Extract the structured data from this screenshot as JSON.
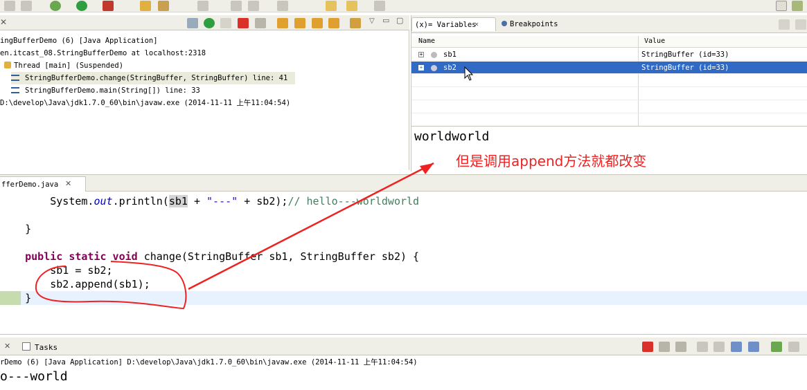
{
  "debug": {
    "items": [
      "ingBufferDemo (6) [Java Application]",
      "en.itcast_08.StringBufferDemo at localhost:2318",
      "Thread [main] (Suspended)",
      "StringBufferDemo.change(StringBuffer, StringBuffer) line: 41",
      "StringBufferDemo.main(String[]) line: 33",
      "D:\\develop\\Java\\jdk1.7.0_60\\bin\\javaw.exe (2014-11-11 上午11:04:54)"
    ]
  },
  "variables": {
    "tab_variables": "(x)= Variables",
    "tab_breakpoints": "Breakpoints",
    "col_name": "Name",
    "col_value": "Value",
    "rows": [
      {
        "name": "sb1",
        "value": "StringBuffer  (id=33)"
      },
      {
        "name": "sb2",
        "value": "StringBuffer  (id=33)"
      }
    ],
    "detail": "worldworld"
  },
  "annotation": {
    "text": "但是调用append方法就都改变",
    "color": "#ee2222"
  },
  "editor": {
    "tab": "fferDemo.java",
    "lines": {
      "l1_a": "        System.",
      "l1_out": "out",
      "l1_b": ".println(",
      "l1_sb1": "sb1",
      "l1_c": " + ",
      "l1_str": "\"---\"",
      "l1_d": " + sb2);",
      "l1_cmt": "// hello---worldworld",
      "l2": "    }",
      "l3_kw": "    public static void",
      "l3_rest": " change(StringBuffer sb1, StringBuffer sb2) {",
      "l4": "        sb1 = sb2;",
      "l5": "        sb2.append(sb1);",
      "l6": "    }"
    }
  },
  "console": {
    "tab_tasks": "Tasks",
    "header": "rDemo (6) [Java Application] D:\\develop\\Java\\jdk1.7.0_60\\bin\\javaw.exe (2014-11-11 上午11:04:54)",
    "output": "o---world"
  }
}
